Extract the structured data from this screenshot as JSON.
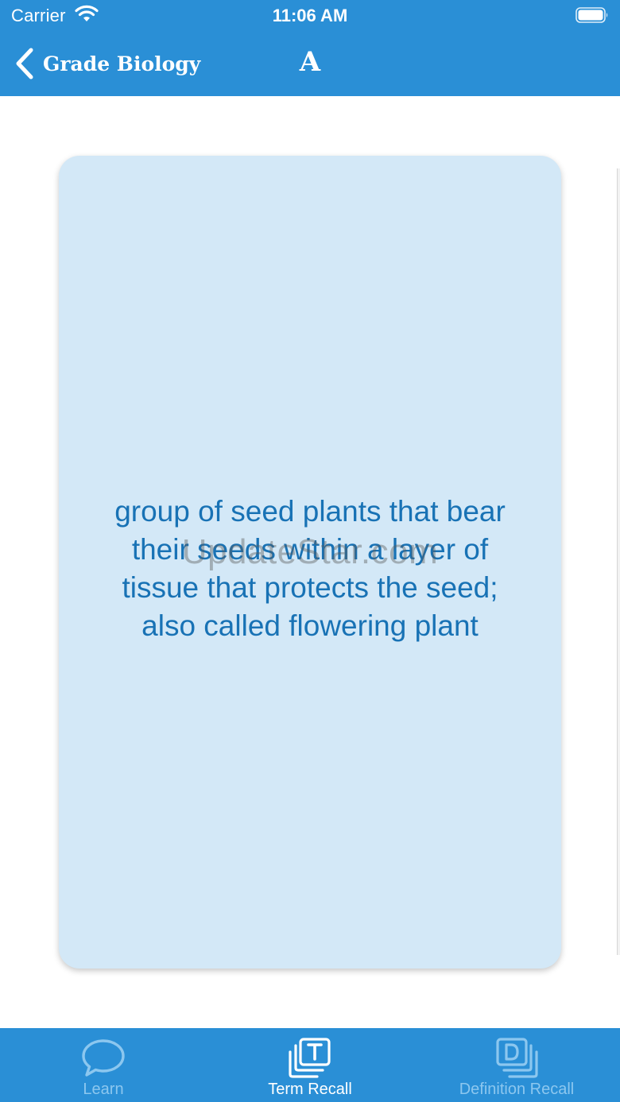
{
  "theme": {
    "accent": "#2a8fd6",
    "card_background": "#d3e8f7",
    "card_text": "#1872b5",
    "tab_inactive": "#8cc7ef",
    "tab_active": "#ffffff"
  },
  "status_bar": {
    "carrier": "Carrier",
    "time": "11:06 AM",
    "wifi_icon": "wifi-icon",
    "battery_icon": "battery-icon"
  },
  "nav": {
    "back_label": "Grade Biology",
    "title": "A"
  },
  "card": {
    "definition": "group of seed plants that bear their seeds within a layer of tissue that protects the seed; also called flowering plant"
  },
  "watermark": "UpdateStar.com",
  "tabs": [
    {
      "label": "Learn",
      "icon": "speech-bubble-icon",
      "active": false
    },
    {
      "label": "Term Recall",
      "icon": "term-cards-icon",
      "active": true
    },
    {
      "label": "Definition Recall",
      "icon": "definition-cards-icon",
      "active": false
    }
  ]
}
